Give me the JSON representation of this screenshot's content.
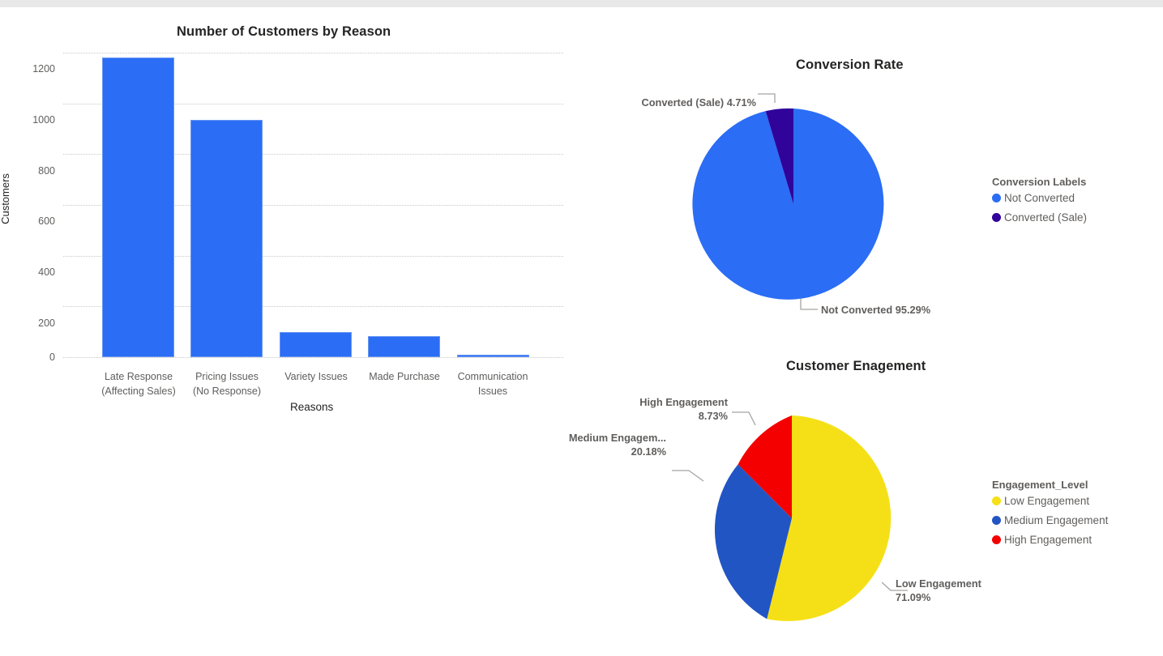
{
  "page": {
    "background": "#ffffff",
    "top_strip_color": "#e8e8e8"
  },
  "bar_chart": {
    "title": "Number of Customers by Reason",
    "xlabel": "Reasons",
    "ylabel": "Customers",
    "bar_color": "#2b6df5"
  },
  "conversion": {
    "title": "Conversion Rate",
    "legend_title": "Conversion Labels",
    "callout_top": "Converted (Sale) 4.71%",
    "callout_bottom": "Not Converted 95.29%"
  },
  "engagement": {
    "title": "Customer Enagement",
    "legend_title": "Engagement_Level",
    "callout_high_name": "High Engagement",
    "callout_high_value": "8.73%",
    "callout_medium_name": "Medium Engagem...",
    "callout_medium_value": "20.18%",
    "callout_low_name": "Low Engagement",
    "callout_low_value": "71.09%"
  },
  "ticks": {
    "t0": "0",
    "t200": "200",
    "t400": "400",
    "t600": "600",
    "t800": "800",
    "t1000": "1000",
    "t1200": "1200"
  },
  "cats": {
    "c0_l1": "Late Response",
    "c0_l2": "(Affecting Sales)",
    "c1_l1": "Pricing Issues",
    "c1_l2": "(No Response)",
    "c2_l1": "Variety Issues",
    "c2_l2": "",
    "c3_l1": "Made Purchase",
    "c3_l2": "",
    "c4_l1": "Communication",
    "c4_l2": "Issues"
  },
  "legend_conversion": {
    "item0_label": "Not Converted",
    "item0_color": "#2b6df5",
    "item1_label": "Converted (Sale)",
    "item1_color": "#30039b"
  },
  "legend_engagement": {
    "item0_label": "Low Engagement",
    "item0_color": "#f5e017",
    "item1_label": "Medium Engagement",
    "item1_color": "#2255c4",
    "item2_label": "High Engagement",
    "item2_color": "#f40000"
  },
  "chart_data": [
    {
      "type": "bar",
      "title": "Number of Customers by Reason",
      "xlabel": "Reasons",
      "ylabel": "Customers",
      "categories": [
        "Late Response (Affecting Sales)",
        "Pricing Issues (No Response)",
        "Variety Issues",
        "Made Purchase",
        "Communication Issues"
      ],
      "values": [
        1180,
        935,
        100,
        82,
        4
      ],
      "ylim": [
        0,
        1200
      ],
      "yticks": [
        0,
        200,
        400,
        600,
        800,
        1000,
        1200
      ],
      "grid": true,
      "bar_color": "#2b6df5",
      "legend": "none"
    },
    {
      "type": "pie",
      "title": "Conversion Rate",
      "legend_title": "Conversion Labels",
      "legend_position": "right",
      "labels": [
        "Not Converted",
        "Converted (Sale)"
      ],
      "values": [
        95.29,
        4.71
      ],
      "value_unit": "percent",
      "colors": [
        "#2b6df5",
        "#30039b"
      ],
      "annotations": [
        "Not Converted 95.29%",
        "Converted (Sale) 4.71%"
      ],
      "start_angle_deg": 0,
      "direction": "clockwise"
    },
    {
      "type": "pie",
      "title": "Customer Enagement",
      "legend_title": "Engagement_Level",
      "legend_position": "right",
      "labels": [
        "Low Engagement",
        "Medium Engagement",
        "High Engagement"
      ],
      "values": [
        71.09,
        20.18,
        8.73
      ],
      "value_unit": "percent",
      "colors": [
        "#f5e017",
        "#2255c4",
        "#f40000"
      ],
      "annotations": [
        "Low Engagement 71.09%",
        "Medium Engagem... 20.18%",
        "High Engagement 8.73%"
      ],
      "start_angle_deg": 0,
      "direction": "clockwise"
    }
  ]
}
